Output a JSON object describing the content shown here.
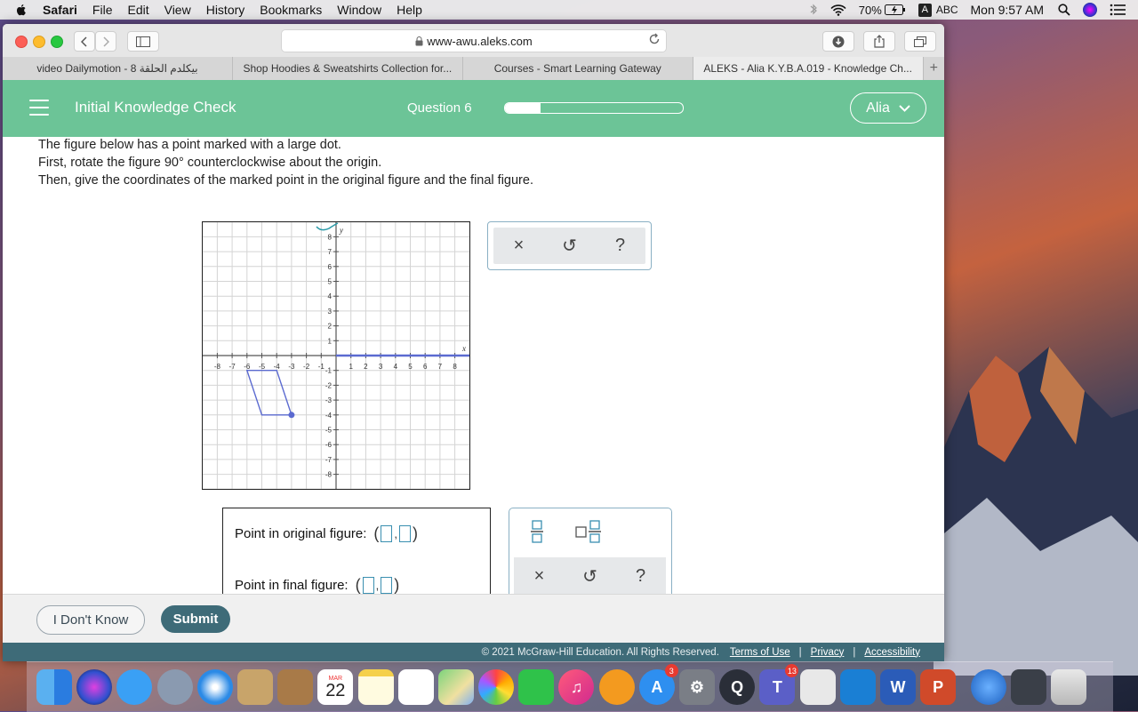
{
  "menubar": {
    "app": "Safari",
    "items": [
      "File",
      "Edit",
      "View",
      "History",
      "Bookmarks",
      "Window",
      "Help"
    ],
    "battery": "70%",
    "input_source": "ABC",
    "clock": "Mon 9:57 AM"
  },
  "browser": {
    "url": "www-awu.aleks.com",
    "tabs": [
      {
        "label": "video Dailymotion - بيكلدم الحلقة 8",
        "active": false
      },
      {
        "label": "Shop Hoodies & Sweatshirts Collection for...",
        "active": false
      },
      {
        "label": "Courses - Smart Learning Gateway",
        "active": false
      },
      {
        "label": "ALEKS - Alia K.Y.B.A.019 - Knowledge Ch...",
        "active": true
      }
    ],
    "new_tab": "+"
  },
  "header": {
    "title": "Initial Knowledge Check",
    "question": "Question 6",
    "progress": 0.2,
    "user": "Alia"
  },
  "problem": {
    "line1": "The figure below has a point marked with a large dot.",
    "line2": "First, rotate the figure 90° counterclockwise about the origin.",
    "line3": "Then, give the coordinates of the marked point in the original figure and the final figure."
  },
  "graph": {
    "x_label": "x",
    "y_label": "y",
    "x_ticks": [
      "-8",
      "-7",
      "-6",
      "-5",
      "-4",
      "-3",
      "-2",
      "-1",
      "1",
      "2",
      "3",
      "4",
      "5",
      "6",
      "7",
      "8"
    ],
    "y_ticks": [
      "8",
      "7",
      "6",
      "5",
      "4",
      "3",
      "2",
      "1",
      "-1",
      "-2",
      "-3",
      "-4",
      "-5",
      "-6",
      "-7",
      "-8"
    ],
    "parallelogram": [
      [
        -6,
        -1
      ],
      [
        -4,
        -1
      ],
      [
        -3,
        -4
      ],
      [
        -5,
        -4
      ]
    ],
    "marked_point": [
      -3,
      -4
    ],
    "colors": {
      "figure": "#5b6ad0",
      "grid": "#d4d4d4",
      "sketch": "#2a9aa8"
    }
  },
  "tools": {
    "clear": "×",
    "undo": "↺",
    "help": "?"
  },
  "answers": {
    "original_label": "Point in original figure:",
    "final_label": "Point in final figure:",
    "open_paren": "(",
    "comma": ",",
    "close_paren": ")"
  },
  "palette": {
    "clear": "×",
    "undo": "↺",
    "help": "?"
  },
  "footer": {
    "dont_know": "I Don't Know",
    "submit": "Submit",
    "copyright": "© 2021 McGraw-Hill Education. All Rights Reserved.",
    "terms": "Terms of Use",
    "privacy": "Privacy",
    "accessibility": "Accessibility",
    "separator": "|"
  },
  "dock": {
    "calendar_month": "MAR",
    "calendar_day": "22",
    "appstore_badge": "3",
    "teams_badge": "13",
    "teams_letter": "T",
    "word_letter": "W",
    "ppt_letter": "P"
  }
}
